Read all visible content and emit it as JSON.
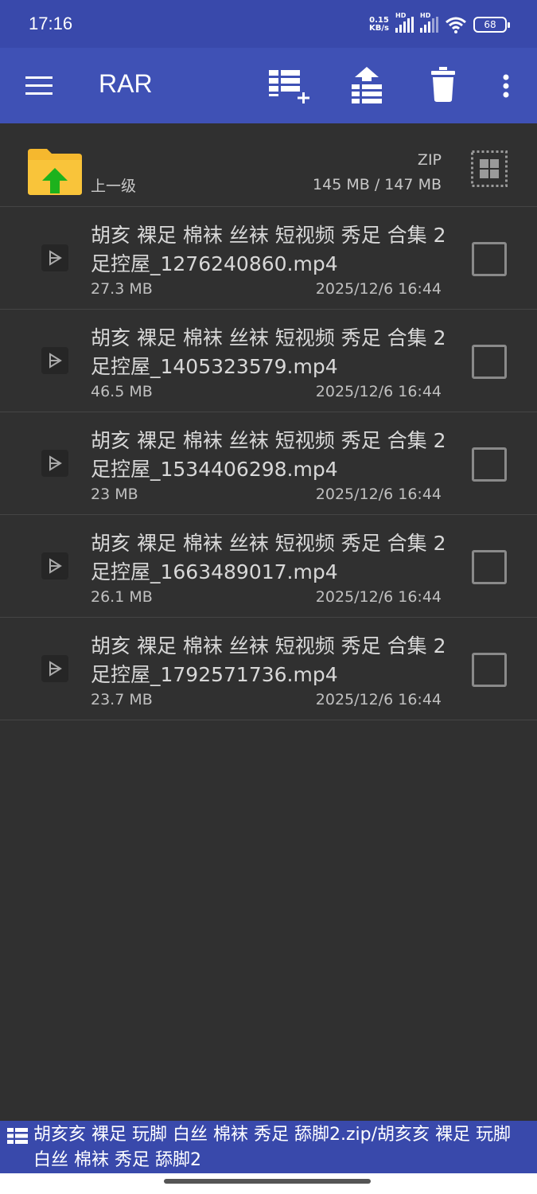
{
  "status": {
    "time": "17:16",
    "net_speed_value": "0.15",
    "net_speed_unit": "KB/s",
    "sim1_label": "HD",
    "sim2_label": "HD",
    "battery": "68"
  },
  "toolbar": {
    "title": "RAR",
    "icons": [
      "menu-icon",
      "add-to-archive-icon",
      "extract-icon",
      "delete-icon",
      "more-vert-icon"
    ]
  },
  "up_dir": {
    "label": "上一级",
    "archive_type": "ZIP",
    "size_info": "145 MB / 147 MB"
  },
  "files": [
    {
      "name": "胡亥 裸足 棉袜 丝袜 短视频 秀足 合集 2 足控屋_1276240860.mp4",
      "size": "27.3 MB",
      "date": "2025/12/6 16:44"
    },
    {
      "name": "胡亥 裸足 棉袜 丝袜 短视频 秀足 合集 2 足控屋_1405323579.mp4",
      "size": "46.5 MB",
      "date": "2025/12/6 16:44"
    },
    {
      "name": "胡亥 裸足 棉袜 丝袜 短视频 秀足 合集 2 足控屋_1534406298.mp4",
      "size": "23 MB",
      "date": "2025/12/6 16:44"
    },
    {
      "name": "胡亥 裸足 棉袜 丝袜 短视频 秀足 合集 2 足控屋_1663489017.mp4",
      "size": "26.1 MB",
      "date": "2025/12/6 16:44"
    },
    {
      "name": "胡亥 裸足 棉袜 丝袜 短视频 秀足 合集 2 足控屋_1792571736.mp4",
      "size": "23.7 MB",
      "date": "2025/12/6 16:44"
    }
  ],
  "path": "胡亥亥 裸足 玩脚 白丝 棉袜 秀足 舔脚2.zip/胡亥亥 裸足 玩脚 白丝 棉袜 秀足 舔脚2",
  "colors": {
    "statusbar": "#3949ab",
    "toolbar": "#3f51b5",
    "background": "#303030",
    "folder": "#f5b82e",
    "up_arrow": "#1db21d"
  }
}
